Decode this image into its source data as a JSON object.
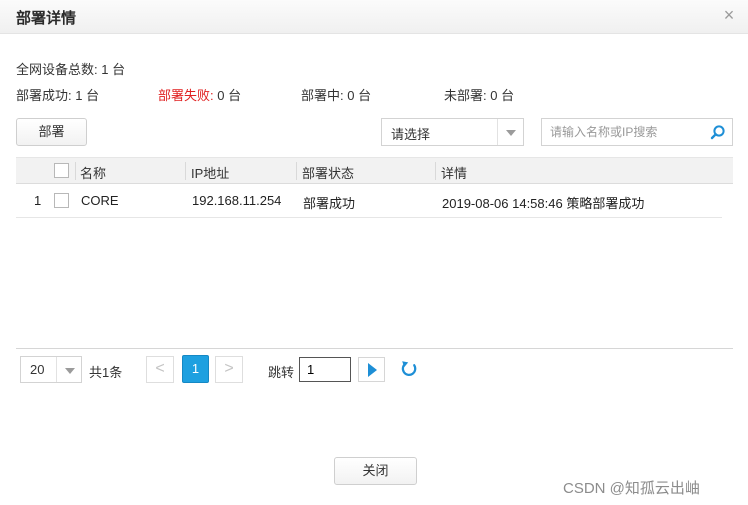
{
  "dialog": {
    "title": "部署详情",
    "close_glyph": "×"
  },
  "summary": {
    "total": "全网设备总数: 1 台",
    "success": {
      "label": "部署成功:",
      "value": " 1 台"
    },
    "failed": {
      "label": "部署失败:",
      "value": " 0 台"
    },
    "deploying": {
      "label": "部署中:",
      "value": " 0 台"
    },
    "undeployed": {
      "label": "未部署:",
      "value": " 0 台"
    }
  },
  "toolbar": {
    "deploy_label": "部署",
    "filter_value": "请选择",
    "search_placeholder": "请输入名称或IP搜索"
  },
  "table": {
    "columns": [
      "名称",
      "IP地址",
      "部署状态",
      "详情"
    ],
    "rows": [
      {
        "index": "1",
        "name": "CORE",
        "ip": "192.168.11.254",
        "status": "部署成功",
        "detail": "2019-08-06 14:58:46 策略部署成功"
      }
    ]
  },
  "pager": {
    "page_size": "20",
    "total": "共1条",
    "prev": "<",
    "current_page": "1",
    "next": ">",
    "jump_label": "跳转",
    "jump_value": "1"
  },
  "footer": {
    "close_label": "关闭"
  },
  "watermark": "CSDN @知孤云出岫",
  "colors": {
    "accent": "#1ea0e0",
    "failed_label": "#e02020",
    "go_arrow": "#1e8fd6"
  }
}
